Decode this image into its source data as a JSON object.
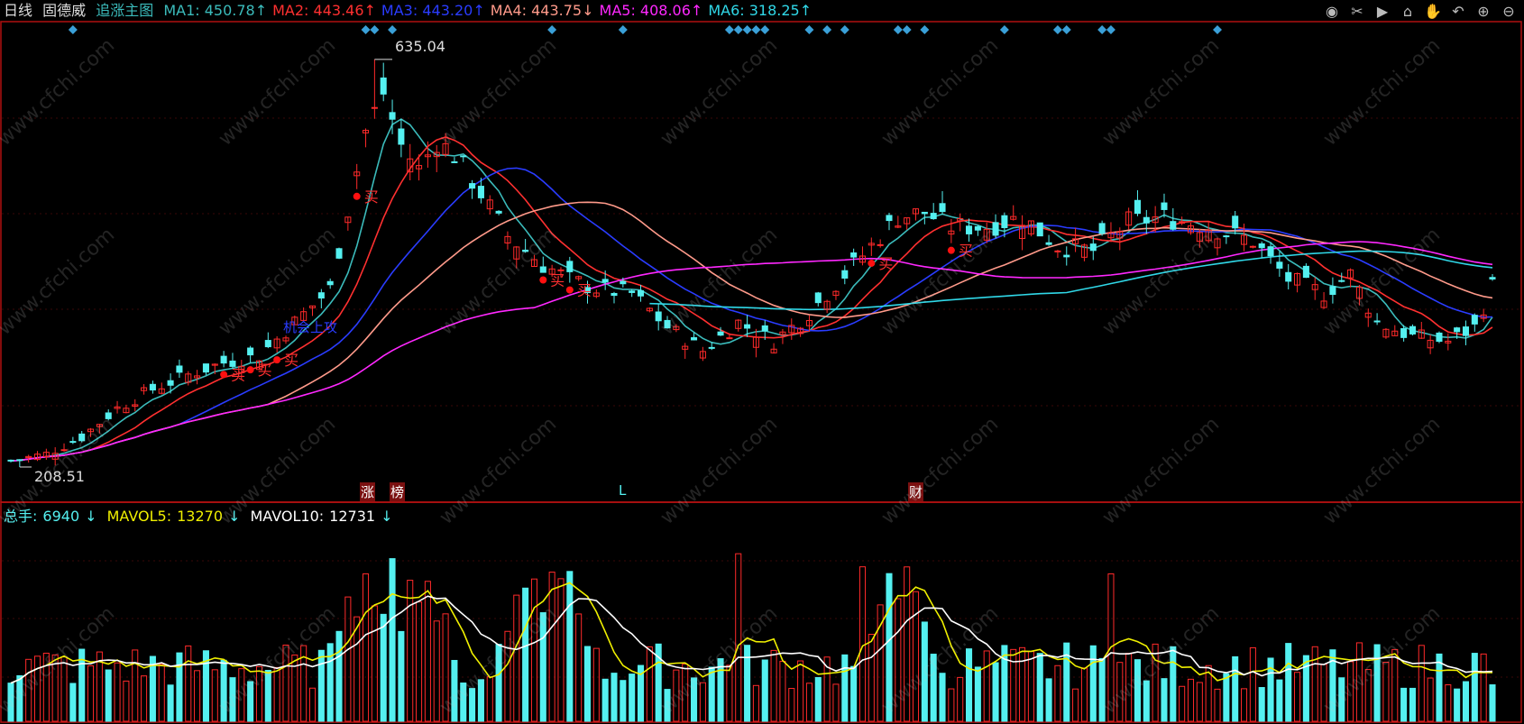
{
  "header": {
    "period": "日线",
    "stock_name": "固德威",
    "indicator_name": "追涨主图",
    "ma": [
      {
        "label": "MA1:",
        "value": "450.78",
        "arrow": "↑",
        "color": "#3bbbbb"
      },
      {
        "label": "MA2:",
        "value": "443.46",
        "arrow": "↑",
        "color": "#ff3030"
      },
      {
        "label": "MA3:",
        "value": "443.20",
        "arrow": "↑",
        "color": "#2a3cff"
      },
      {
        "label": "MA4:",
        "value": "443.75",
        "arrow": "↓",
        "color": "#ff9a8a"
      },
      {
        "label": "MA5:",
        "value": "408.06",
        "arrow": "↑",
        "color": "#ff28ff"
      },
      {
        "label": "MA6:",
        "value": "318.25",
        "arrow": "↑",
        "color": "#30d8e8"
      }
    ]
  },
  "annotations": {
    "high_label": "635.04",
    "low_label": "208.51",
    "buy_label": "买",
    "signal_text": "机会上攻",
    "bottom_marks": [
      "涨",
      "榜",
      "L",
      "财"
    ]
  },
  "volume_header": {
    "total": {
      "label": "总手:",
      "value": "6940",
      "arrow": "↓"
    },
    "mavol5": {
      "label": "MAVOL5:",
      "value": "13270",
      "arrow": "↓"
    },
    "mavol10": {
      "label": "MAVOL10:",
      "value": "12731",
      "arrow": "↓"
    }
  },
  "toolbar": {
    "icons": [
      "eye-icon",
      "scissors-icon",
      "play-icon",
      "lock-icon",
      "hand-icon",
      "undo-icon",
      "zoom-in-icon",
      "zoom-out-icon"
    ]
  },
  "watermark": "www.cfchi.com",
  "colors": {
    "up": "#ff2a2a",
    "down": "#54f0f0",
    "frame": "#b01010",
    "ma1": "#3bbbbb",
    "ma2": "#ff3030",
    "ma3": "#2a3cff",
    "ma4": "#ff9a8a",
    "ma5": "#ff28ff",
    "ma6": "#30d8e8",
    "mavol5": "#f0f000",
    "mavol10": "#ffffff"
  },
  "chart_data": {
    "type": "candlestick",
    "price_range": [
      200,
      650
    ],
    "high": 635.04,
    "low": 208.51,
    "candle_count": 168,
    "anchors": [
      [
        0,
        215
      ],
      [
        4,
        222
      ],
      [
        8,
        240
      ],
      [
        12,
        270
      ],
      [
        16,
        290
      ],
      [
        20,
        305
      ],
      [
        24,
        318
      ],
      [
        28,
        325
      ],
      [
        32,
        360
      ],
      [
        36,
        395
      ],
      [
        40,
        560
      ],
      [
        42,
        600
      ],
      [
        44,
        545
      ],
      [
        46,
        520
      ],
      [
        48,
        550
      ],
      [
        50,
        535
      ],
      [
        53,
        495
      ],
      [
        56,
        450
      ],
      [
        60,
        420
      ],
      [
        63,
        405
      ],
      [
        66,
        395
      ],
      [
        70,
        390
      ],
      [
        74,
        355
      ],
      [
        78,
        330
      ],
      [
        82,
        360
      ],
      [
        86,
        340
      ],
      [
        90,
        370
      ],
      [
        95,
        420
      ],
      [
        100,
        470
      ],
      [
        103,
        475
      ],
      [
        106,
        460
      ],
      [
        110,
        460
      ],
      [
        114,
        470
      ],
      [
        118,
        440
      ],
      [
        122,
        435
      ],
      [
        126,
        465
      ],
      [
        130,
        470
      ],
      [
        135,
        460
      ],
      [
        140,
        445
      ],
      [
        144,
        405
      ],
      [
        148,
        390
      ],
      [
        151,
        410
      ],
      [
        154,
        360
      ],
      [
        158,
        345
      ],
      [
        162,
        340
      ],
      [
        165,
        355
      ],
      [
        167,
        398
      ]
    ],
    "volume_range": [
      0,
      36000
    ],
    "ma_series": [
      "MA1",
      "MA2",
      "MA3",
      "MA4",
      "MA5",
      "MA6"
    ],
    "volume_series": [
      "总手",
      "MAVOL5",
      "MAVOL10"
    ]
  }
}
